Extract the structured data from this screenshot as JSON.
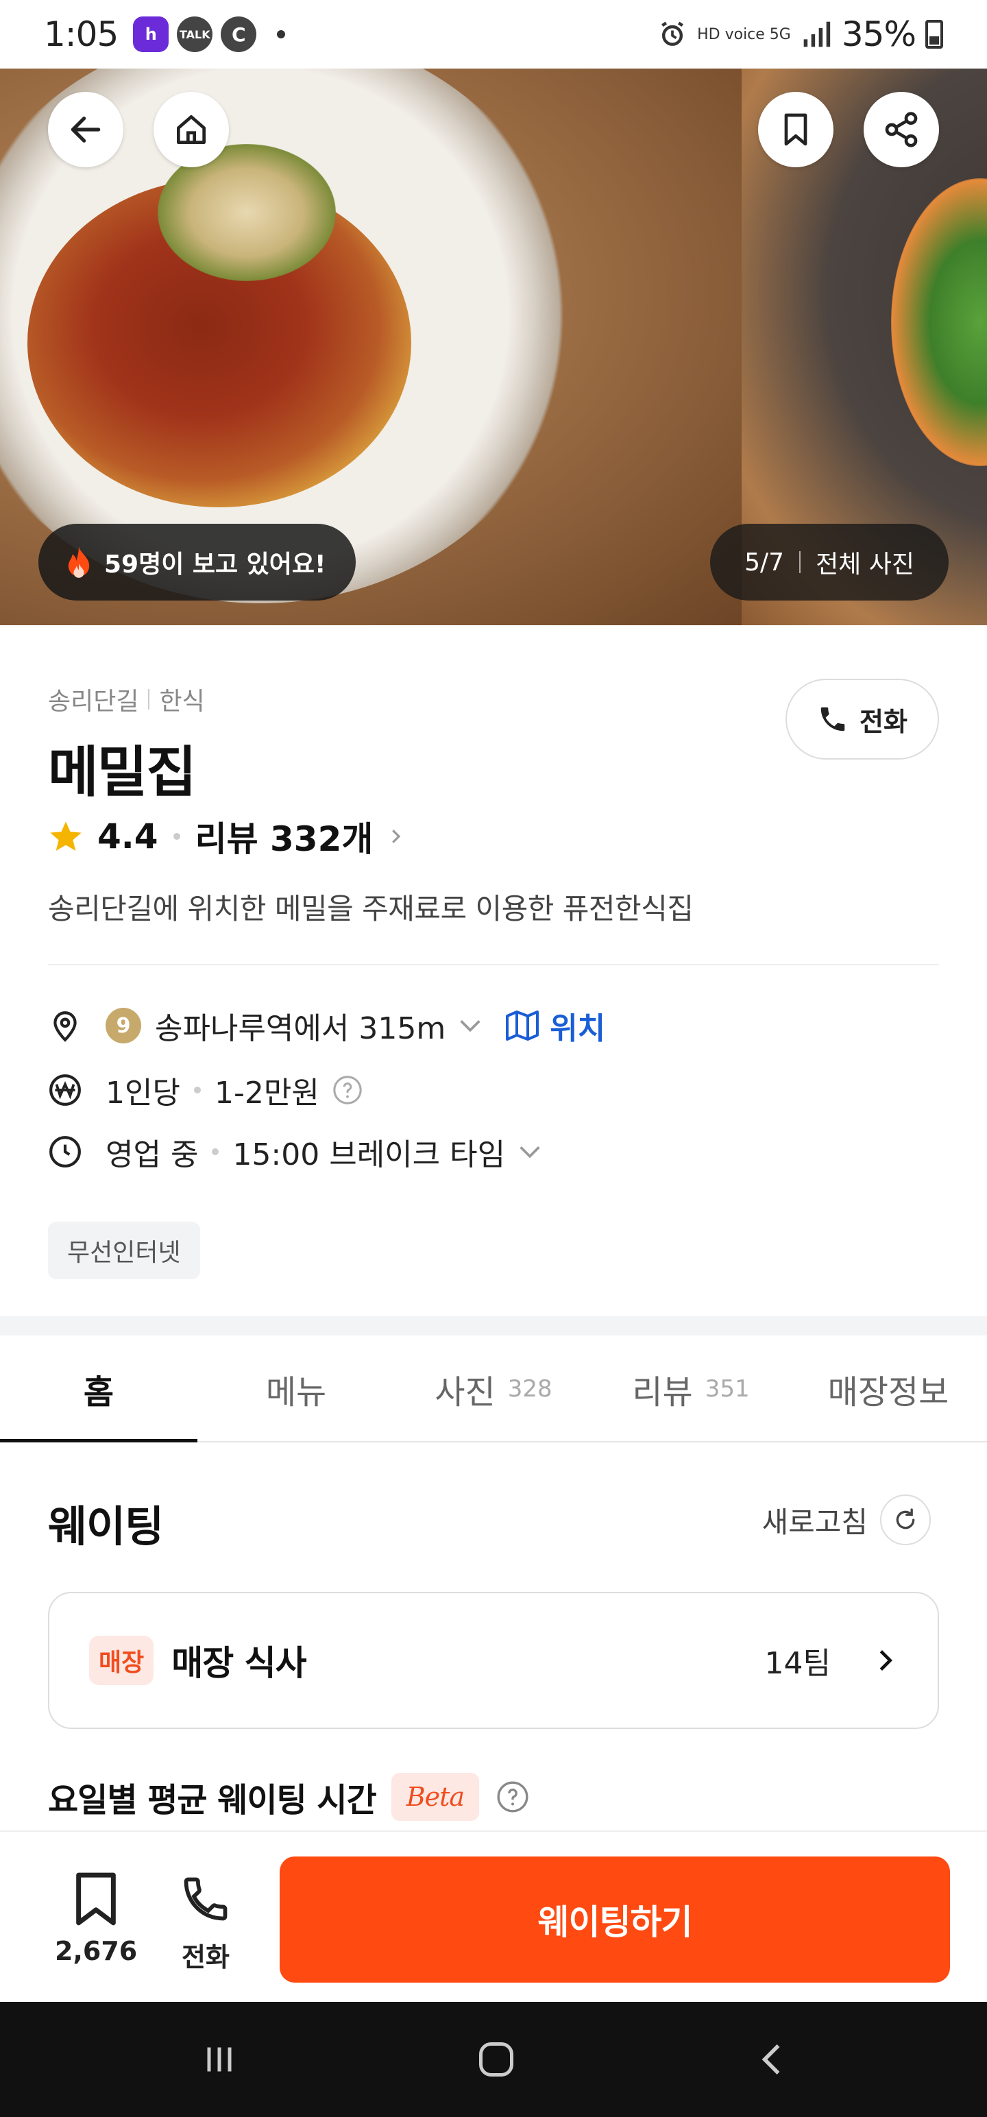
{
  "status_bar": {
    "time": "1:05",
    "apps": [
      "h",
      "TALK",
      "C"
    ],
    "network": "HD voice 5G",
    "battery": "35%"
  },
  "hero": {
    "viewers_text": "59명이 보고 있어요!",
    "photo_index": "5/7",
    "all_photos_label": "전체 사진"
  },
  "restaurant": {
    "area": "송리단길",
    "cuisine": "한식",
    "name": "메밀집",
    "rating": "4.4",
    "review_label": "리뷰 332개",
    "description": "송리단길에 위치한 메밀을 주재료로 이용한 퓨전한식집",
    "call_label": "전화",
    "subway_line": "9",
    "distance_text": "송파나루역에서 315m",
    "map_label": "위치",
    "price_unit": "1인당",
    "price_range": "1-2만원",
    "status": "영업 중",
    "hours_text": "15:00 브레이크 타임",
    "tags": [
      "무선인터넷"
    ]
  },
  "tabs": [
    {
      "label": "홈",
      "count": ""
    },
    {
      "label": "메뉴",
      "count": ""
    },
    {
      "label": "사진",
      "count": "328"
    },
    {
      "label": "리뷰",
      "count": "351"
    },
    {
      "label": "매장정보",
      "count": ""
    }
  ],
  "waiting": {
    "title": "웨이팅",
    "refresh_label": "새로고침",
    "card_badge": "매장",
    "card_label": "매장 식사",
    "card_teams": "14팀",
    "avg_title": "요일별 평균 웨이팅 시간",
    "beta_label": "Beta"
  },
  "bottom_bar": {
    "bookmark_count": "2,676",
    "call_label": "전화",
    "cta_label": "웨이팅하기"
  },
  "colors": {
    "accent": "#ff4a12",
    "link_blue": "#1a5ed6",
    "star": "#f5b400"
  }
}
